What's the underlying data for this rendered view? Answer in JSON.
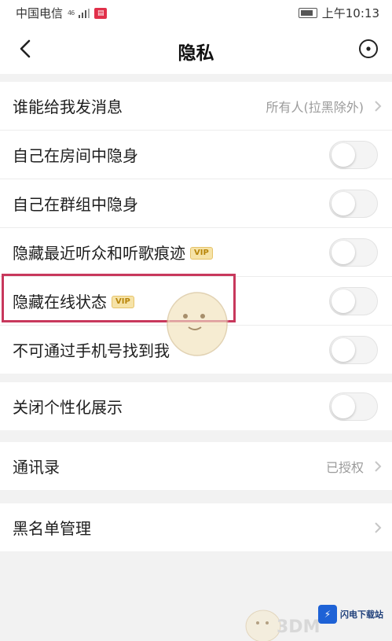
{
  "statusbar": {
    "carrier": "中国电信",
    "network": "46",
    "time": "上午10:13"
  },
  "header": {
    "title": "隐私"
  },
  "vip_badge": "VIP",
  "group1": [
    {
      "label": "谁能给我发消息",
      "value": "所有人(拉黑除外)"
    },
    {
      "label": "自己在房间中隐身",
      "toggle": false
    },
    {
      "label": "自己在群组中隐身",
      "toggle": false
    },
    {
      "label": "隐藏最近听众和听歌痕迹",
      "vip": true,
      "toggle": false
    },
    {
      "label": "隐藏在线状态",
      "vip": true,
      "toggle": false
    },
    {
      "label": "不可通过手机号找到我",
      "toggle": false
    }
  ],
  "group2": [
    {
      "label": "关闭个性化展示",
      "toggle": false
    }
  ],
  "group3": [
    {
      "label": "通讯录",
      "value": "已授权"
    }
  ],
  "group4": [
    {
      "label": "黑名单管理"
    }
  ],
  "watermark": {
    "text": "3DM",
    "site": "闪电下载站"
  },
  "colors": {
    "highlight": "#c8385c",
    "vip_bg": "#f6e3a8"
  }
}
